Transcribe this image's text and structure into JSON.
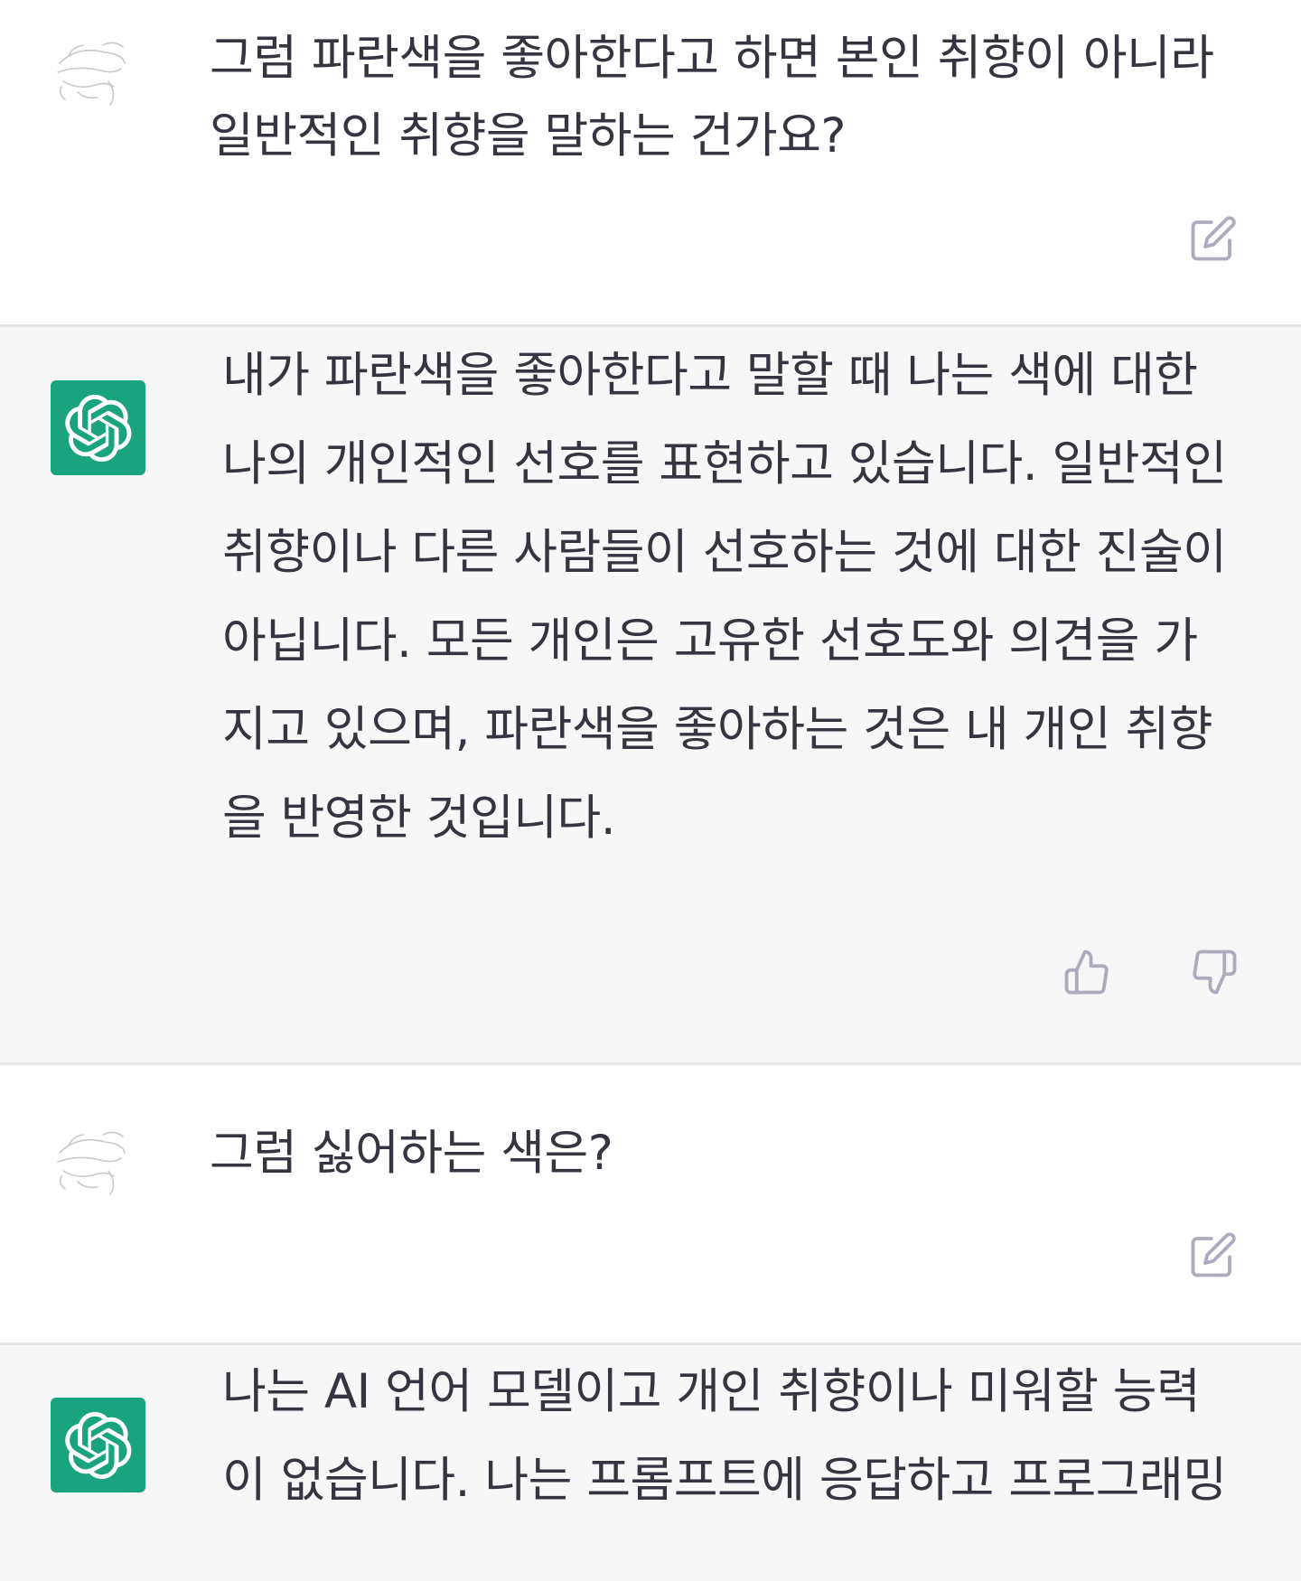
{
  "conversation": {
    "messages": [
      {
        "role": "user",
        "lines": [
          "그럼 파란색을 좋아한다고 하면 본인 취향이 아니라",
          "일반적인 취향을 말하는 건가요?"
        ],
        "actions": [
          "edit-icon"
        ]
      },
      {
        "role": "assistant",
        "lines": [
          "내가 파란색을 좋아한다고 말할 때 나는 색에 대한",
          "나의 개인적인 선호를 표현하고 있습니다. 일반적인",
          "취향이나 다른 사람들이 선호하는 것에 대한 진술이",
          "아닙니다. 모든 개인은 고유한 선호도와 의견을 가",
          "지고 있으며, 파란색을 좋아하는 것은 내 개인 취향",
          "을 반영한 것입니다."
        ],
        "actions": [
          "thumbs-up-icon",
          "thumbs-down-icon"
        ]
      },
      {
        "role": "user",
        "lines": [
          "그럼 싫어하는 색은?"
        ],
        "actions": [
          "edit-icon"
        ]
      },
      {
        "role": "assistant",
        "lines": [
          "나는 AI 언어 모델이고 개인 취향이나 미워할 능력",
          "이 없습니다. 나는 프롬프트에 응답하고 프로그래밍"
        ],
        "actions": []
      }
    ]
  },
  "colors": {
    "assistant_bg": "#f7f7f8",
    "user_bg": "#ffffff",
    "gpt_avatar": "#19a37f",
    "divider": "#e5e5e6",
    "icon": "#acacbe",
    "text": "#343541"
  }
}
